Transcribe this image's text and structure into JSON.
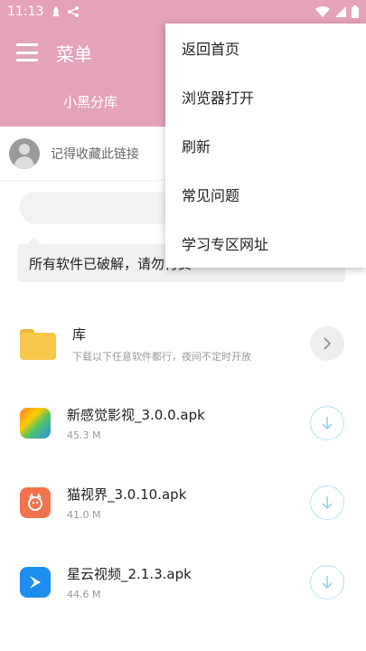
{
  "status_bar": {
    "time": "11:13"
  },
  "header": {
    "title": "菜单",
    "tab_label": "小黑分库"
  },
  "share": {
    "text": "记得收藏此链接"
  },
  "notice": {
    "text": "所有软件已破解，请勿付费"
  },
  "list": {
    "folder": {
      "title": "库",
      "subtitle": "下载以下任意软件都行，夜间不定时开放"
    },
    "apps": [
      {
        "name": "新感觉影视_3.0.0.apk",
        "size": "45.3 M"
      },
      {
        "name": "猫视界_3.0.10.apk",
        "size": "41.0 M"
      },
      {
        "name": "星云视频_2.1.3.apk",
        "size": "44.6 M"
      }
    ]
  },
  "popup_menu": {
    "items": [
      "返回首页",
      "浏览器打开",
      "刷新",
      "常见问题",
      "学习专区网址"
    ]
  },
  "colors": {
    "header": "#e4a3b8",
    "accent": "#b9e1f2"
  }
}
